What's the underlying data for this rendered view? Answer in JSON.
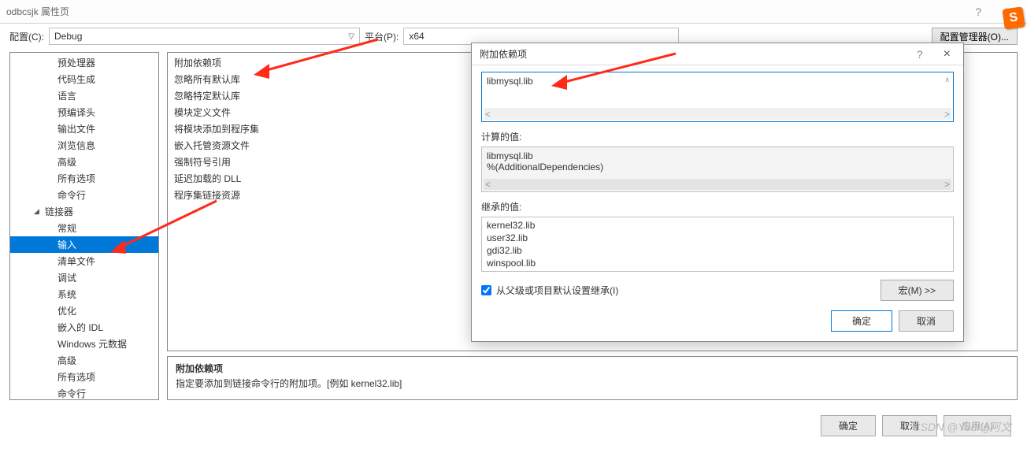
{
  "titlebar": {
    "title": "odbcsjk 属性页",
    "help": "?",
    "close": "×"
  },
  "toolbar": {
    "config_label": "配置(C):",
    "config_value": "Debug",
    "platform_label": "平台(P):",
    "platform_value": "x64",
    "manager_label": "配置管理器(O)..."
  },
  "tree": {
    "items_a": [
      "预处理器",
      "代码生成",
      "语言",
      "预编译头",
      "输出文件",
      "浏览信息",
      "高级",
      "所有选项",
      "命令行"
    ],
    "linker_label": "链接器",
    "items_b": [
      "常规"
    ],
    "selected": "输入",
    "items_c": [
      "清单文件",
      "调试",
      "系统",
      "优化",
      "嵌入的 IDL",
      "Windows 元数据",
      "高级",
      "所有选项",
      "命令行"
    ]
  },
  "props": {
    "rows": [
      "附加依赖项",
      "忽略所有默认库",
      "忽略特定默认库",
      "模块定义文件",
      "将模块添加到程序集",
      "嵌入托管资源文件",
      "强制符号引用",
      "延迟加载的 DLL",
      "程序集链接资源"
    ]
  },
  "desc": {
    "title": "附加依赖项",
    "body": "指定要添加到链接命令行的附加项。[例如 kernel32.lib]"
  },
  "footer": {
    "ok": "确定",
    "cancel": "取消",
    "apply": "应用(A)"
  },
  "modal": {
    "title": "附加依赖项",
    "help": "?",
    "close": "×",
    "edit_value": "libmysql.lib",
    "computed_label": "计算的值:",
    "computed_lines": [
      "libmysql.lib",
      "%(AdditionalDependencies)"
    ],
    "inherited_label": "继承的值:",
    "inherited_items": [
      "kernel32.lib",
      "user32.lib",
      "gdi32.lib",
      "winspool.lib"
    ],
    "inherit_check": "从父级或项目默认设置继承(I)",
    "macro_btn": "宏(M) >>",
    "ok": "确定",
    "cancel": "取消"
  },
  "watermark": "CSDN @Young阿文",
  "badge": "S"
}
